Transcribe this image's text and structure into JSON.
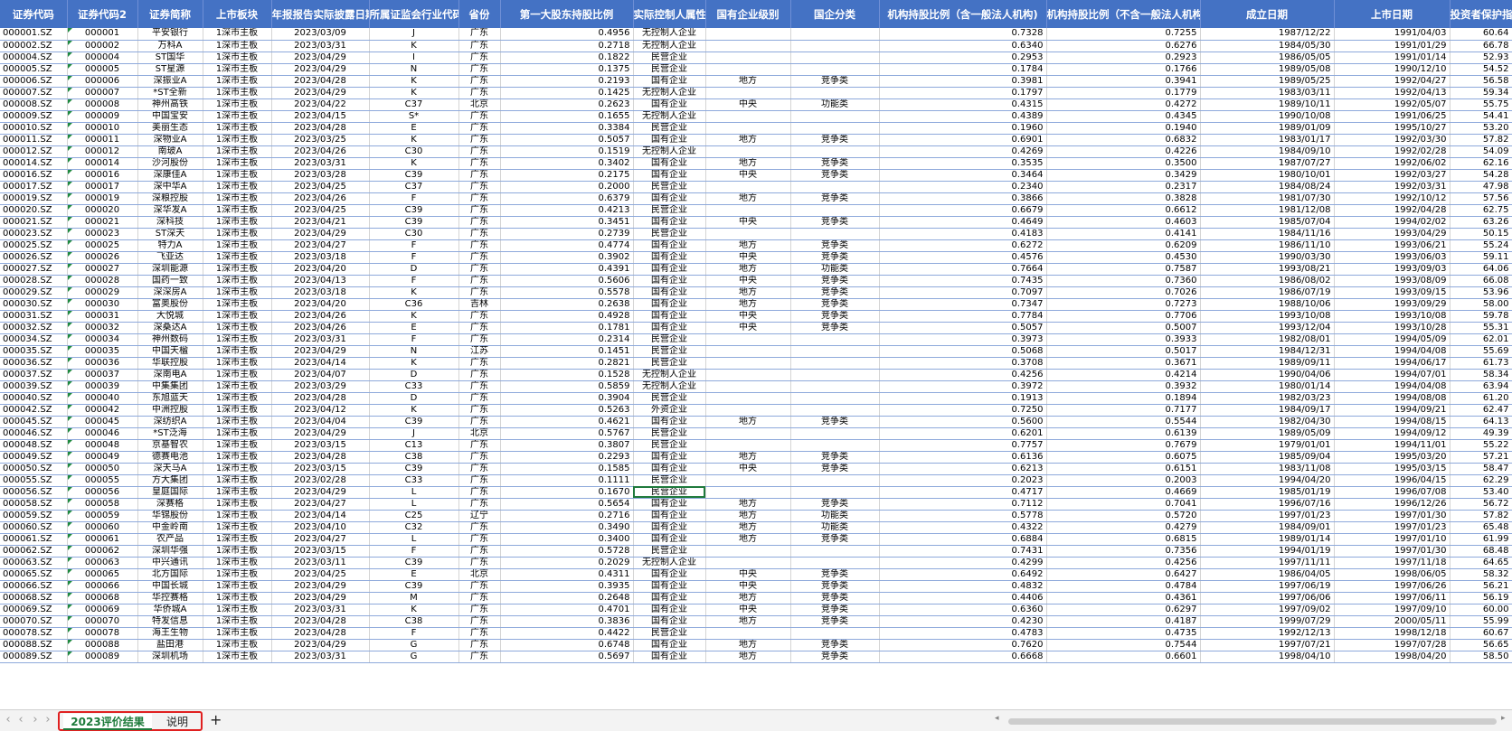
{
  "columns": [
    {
      "label": "证券代码",
      "align": "l"
    },
    {
      "label": "证券代码2",
      "align": "c"
    },
    {
      "label": "证券简称",
      "align": "c"
    },
    {
      "label": "上市板块",
      "align": "c"
    },
    {
      "label": "年报报告实际披露日期",
      "align": "c"
    },
    {
      "label": "所属证监会行业代码",
      "align": "c"
    },
    {
      "label": "省份",
      "align": "c"
    },
    {
      "label": "第一大股东持股比例",
      "align": "r"
    },
    {
      "label": "实际控制人属性",
      "align": "c"
    },
    {
      "label": "国有企业级别",
      "align": "c"
    },
    {
      "label": "国企分类",
      "align": "c"
    },
    {
      "label": "机构持股比例（含一般法人机构)",
      "align": "r"
    },
    {
      "label": "机构持股比例（不含一般法人机构)",
      "align": "r"
    },
    {
      "label": "成立日期",
      "align": "r"
    },
    {
      "label": "上市日期",
      "align": "r"
    },
    {
      "label": "投资者保护指数",
      "align": "r"
    }
  ],
  "rows": [
    [
      "000001.SZ",
      "000001",
      "平安银行",
      "1深市主板",
      "2023/03/09",
      "J",
      "广东",
      "0.4956",
      "无控制人企业",
      "",
      "",
      "0.7328",
      "0.7255",
      "1987/12/22",
      "1991/04/03",
      "60.64"
    ],
    [
      "000002.SZ",
      "000002",
      "万科A",
      "1深市主板",
      "2023/03/31",
      "K",
      "广东",
      "0.2718",
      "无控制人企业",
      "",
      "",
      "0.6340",
      "0.6276",
      "1984/05/30",
      "1991/01/29",
      "66.78"
    ],
    [
      "000004.SZ",
      "000004",
      "ST国华",
      "1深市主板",
      "2023/04/29",
      "I",
      "广东",
      "0.1822",
      "民营企业",
      "",
      "",
      "0.2953",
      "0.2923",
      "1986/05/05",
      "1991/01/14",
      "52.93"
    ],
    [
      "000005.SZ",
      "000005",
      "ST星源",
      "1深市主板",
      "2023/04/29",
      "N",
      "广东",
      "0.1375",
      "民营企业",
      "",
      "",
      "0.1784",
      "0.1766",
      "1989/05/08",
      "1990/12/10",
      "54.52"
    ],
    [
      "000006.SZ",
      "000006",
      "深振业A",
      "1深市主板",
      "2023/04/28",
      "K",
      "广东",
      "0.2193",
      "国有企业",
      "地方",
      "竞争类",
      "0.3981",
      "0.3941",
      "1989/05/25",
      "1992/04/27",
      "56.58"
    ],
    [
      "000007.SZ",
      "000007",
      "*ST全新",
      "1深市主板",
      "2023/04/29",
      "K",
      "广东",
      "0.1425",
      "无控制人企业",
      "",
      "",
      "0.1797",
      "0.1779",
      "1983/03/11",
      "1992/04/13",
      "59.34"
    ],
    [
      "000008.SZ",
      "000008",
      "神州高铁",
      "1深市主板",
      "2023/04/22",
      "C37",
      "北京",
      "0.2623",
      "国有企业",
      "中央",
      "功能类",
      "0.4315",
      "0.4272",
      "1989/10/11",
      "1992/05/07",
      "55.75"
    ],
    [
      "000009.SZ",
      "000009",
      "中国宝安",
      "1深市主板",
      "2023/04/15",
      "S*",
      "广东",
      "0.1655",
      "无控制人企业",
      "",
      "",
      "0.4389",
      "0.4345",
      "1990/10/08",
      "1991/06/25",
      "54.41"
    ],
    [
      "000010.SZ",
      "000010",
      "美丽生态",
      "1深市主板",
      "2023/04/28",
      "E",
      "广东",
      "0.3384",
      "民营企业",
      "",
      "",
      "0.1960",
      "0.1940",
      "1989/01/09",
      "1995/10/27",
      "53.20"
    ],
    [
      "000011.SZ",
      "000011",
      "深物业A",
      "1深市主板",
      "2023/03/25",
      "K",
      "广东",
      "0.5057",
      "国有企业",
      "地方",
      "竞争类",
      "0.6901",
      "0.6832",
      "1983/01/17",
      "1992/03/30",
      "57.82"
    ],
    [
      "000012.SZ",
      "000012",
      "南玻A",
      "1深市主板",
      "2023/04/26",
      "C30",
      "广东",
      "0.1519",
      "无控制人企业",
      "",
      "",
      "0.4269",
      "0.4226",
      "1984/09/10",
      "1992/02/28",
      "54.09"
    ],
    [
      "000014.SZ",
      "000014",
      "沙河股份",
      "1深市主板",
      "2023/03/31",
      "K",
      "广东",
      "0.3402",
      "国有企业",
      "地方",
      "竞争类",
      "0.3535",
      "0.3500",
      "1987/07/27",
      "1992/06/02",
      "62.16"
    ],
    [
      "000016.SZ",
      "000016",
      "深康佳A",
      "1深市主板",
      "2023/03/28",
      "C39",
      "广东",
      "0.2175",
      "国有企业",
      "中央",
      "竞争类",
      "0.3464",
      "0.3429",
      "1980/10/01",
      "1992/03/27",
      "54.28"
    ],
    [
      "000017.SZ",
      "000017",
      "深中华A",
      "1深市主板",
      "2023/04/25",
      "C37",
      "广东",
      "0.2000",
      "民营企业",
      "",
      "",
      "0.2340",
      "0.2317",
      "1984/08/24",
      "1992/03/31",
      "47.98"
    ],
    [
      "000019.SZ",
      "000019",
      "深粮控股",
      "1深市主板",
      "2023/04/26",
      "F",
      "广东",
      "0.6379",
      "国有企业",
      "地方",
      "竞争类",
      "0.3866",
      "0.3828",
      "1981/07/30",
      "1992/10/12",
      "57.56"
    ],
    [
      "000020.SZ",
      "000020",
      "深华发A",
      "1深市主板",
      "2023/04/25",
      "C39",
      "广东",
      "0.4213",
      "民营企业",
      "",
      "",
      "0.6679",
      "0.6612",
      "1981/12/08",
      "1992/04/28",
      "62.75"
    ],
    [
      "000021.SZ",
      "000021",
      "深科技",
      "1深市主板",
      "2023/04/21",
      "C39",
      "广东",
      "0.3451",
      "国有企业",
      "中央",
      "竞争类",
      "0.4649",
      "0.4603",
      "1985/07/04",
      "1994/02/02",
      "63.26"
    ],
    [
      "000023.SZ",
      "000023",
      "ST深天",
      "1深市主板",
      "2023/04/29",
      "C30",
      "广东",
      "0.2739",
      "民营企业",
      "",
      "",
      "0.4183",
      "0.4141",
      "1984/11/16",
      "1993/04/29",
      "50.15"
    ],
    [
      "000025.SZ",
      "000025",
      "特力A",
      "1深市主板",
      "2023/04/27",
      "F",
      "广东",
      "0.4774",
      "国有企业",
      "地方",
      "竞争类",
      "0.6272",
      "0.6209",
      "1986/11/10",
      "1993/06/21",
      "55.24"
    ],
    [
      "000026.SZ",
      "000026",
      "飞亚达",
      "1深市主板",
      "2023/03/18",
      "F",
      "广东",
      "0.3902",
      "国有企业",
      "中央",
      "竞争类",
      "0.4576",
      "0.4530",
      "1990/03/30",
      "1993/06/03",
      "59.11"
    ],
    [
      "000027.SZ",
      "000027",
      "深圳能源",
      "1深市主板",
      "2023/04/20",
      "D",
      "广东",
      "0.4391",
      "国有企业",
      "地方",
      "功能类",
      "0.7664",
      "0.7587",
      "1993/08/21",
      "1993/09/03",
      "64.06"
    ],
    [
      "000028.SZ",
      "000028",
      "国药一致",
      "1深市主板",
      "2023/04/13",
      "F",
      "广东",
      "0.5606",
      "国有企业",
      "中央",
      "竞争类",
      "0.7435",
      "0.7360",
      "1986/08/02",
      "1993/08/09",
      "66.08"
    ],
    [
      "000029.SZ",
      "000029",
      "深深房A",
      "1深市主板",
      "2023/03/18",
      "K",
      "广东",
      "0.5578",
      "国有企业",
      "地方",
      "竞争类",
      "0.7097",
      "0.7026",
      "1986/07/19",
      "1993/09/15",
      "53.96"
    ],
    [
      "000030.SZ",
      "000030",
      "富奥股份",
      "1深市主板",
      "2023/04/20",
      "C36",
      "吉林",
      "0.2638",
      "国有企业",
      "地方",
      "竞争类",
      "0.7347",
      "0.7273",
      "1988/10/06",
      "1993/09/29",
      "58.00"
    ],
    [
      "000031.SZ",
      "000031",
      "大悦城",
      "1深市主板",
      "2023/04/26",
      "K",
      "广东",
      "0.4928",
      "国有企业",
      "中央",
      "竞争类",
      "0.7784",
      "0.7706",
      "1993/10/08",
      "1993/10/08",
      "59.78"
    ],
    [
      "000032.SZ",
      "000032",
      "深桑达A",
      "1深市主板",
      "2023/04/26",
      "E",
      "广东",
      "0.1781",
      "国有企业",
      "中央",
      "竞争类",
      "0.5057",
      "0.5007",
      "1993/12/04",
      "1993/10/28",
      "55.31"
    ],
    [
      "000034.SZ",
      "000034",
      "神州数码",
      "1深市主板",
      "2023/03/31",
      "F",
      "广东",
      "0.2314",
      "民营企业",
      "",
      "",
      "0.3973",
      "0.3933",
      "1982/08/01",
      "1994/05/09",
      "62.01"
    ],
    [
      "000035.SZ",
      "000035",
      "中国天楹",
      "1深市主板",
      "2023/04/29",
      "N",
      "江苏",
      "0.1451",
      "民营企业",
      "",
      "",
      "0.5068",
      "0.5017",
      "1984/12/31",
      "1994/04/08",
      "55.69"
    ],
    [
      "000036.SZ",
      "000036",
      "华联控股",
      "1深市主板",
      "2023/04/14",
      "K",
      "广东",
      "0.2821",
      "民营企业",
      "",
      "",
      "0.3708",
      "0.3671",
      "1989/09/11",
      "1994/06/17",
      "61.73"
    ],
    [
      "000037.SZ",
      "000037",
      "深南电A",
      "1深市主板",
      "2023/04/07",
      "D",
      "广东",
      "0.1528",
      "无控制人企业",
      "",
      "",
      "0.4256",
      "0.4214",
      "1990/04/06",
      "1994/07/01",
      "58.34"
    ],
    [
      "000039.SZ",
      "000039",
      "中集集团",
      "1深市主板",
      "2023/03/29",
      "C33",
      "广东",
      "0.5859",
      "无控制人企业",
      "",
      "",
      "0.3972",
      "0.3932",
      "1980/01/14",
      "1994/04/08",
      "63.94"
    ],
    [
      "000040.SZ",
      "000040",
      "东旭蓝天",
      "1深市主板",
      "2023/04/28",
      "D",
      "广东",
      "0.3904",
      "民营企业",
      "",
      "",
      "0.1913",
      "0.1894",
      "1982/03/23",
      "1994/08/08",
      "61.20"
    ],
    [
      "000042.SZ",
      "000042",
      "中洲控股",
      "1深市主板",
      "2023/04/12",
      "K",
      "广东",
      "0.5263",
      "外资企业",
      "",
      "",
      "0.7250",
      "0.7177",
      "1984/09/17",
      "1994/09/21",
      "62.47"
    ],
    [
      "000045.SZ",
      "000045",
      "深纺织A",
      "1深市主板",
      "2023/04/04",
      "C39",
      "广东",
      "0.4621",
      "国有企业",
      "地方",
      "竞争类",
      "0.5600",
      "0.5544",
      "1982/04/30",
      "1994/08/15",
      "64.13"
    ],
    [
      "000046.SZ",
      "000046",
      "*ST泛海",
      "1深市主板",
      "2023/04/29",
      "J",
      "北京",
      "0.5767",
      "民营企业",
      "",
      "",
      "0.6201",
      "0.6139",
      "1989/05/09",
      "1994/09/12",
      "49.39"
    ],
    [
      "000048.SZ",
      "000048",
      "京基智农",
      "1深市主板",
      "2023/03/15",
      "C13",
      "广东",
      "0.3807",
      "民营企业",
      "",
      "",
      "0.7757",
      "0.7679",
      "1979/01/01",
      "1994/11/01",
      "55.22"
    ],
    [
      "000049.SZ",
      "000049",
      "德赛电池",
      "1深市主板",
      "2023/04/28",
      "C38",
      "广东",
      "0.2293",
      "国有企业",
      "地方",
      "竞争类",
      "0.6136",
      "0.6075",
      "1985/09/04",
      "1995/03/20",
      "57.21"
    ],
    [
      "000050.SZ",
      "000050",
      "深天马A",
      "1深市主板",
      "2023/03/15",
      "C39",
      "广东",
      "0.1585",
      "国有企业",
      "中央",
      "竞争类",
      "0.6213",
      "0.6151",
      "1983/11/08",
      "1995/03/15",
      "58.47"
    ],
    [
      "000055.SZ",
      "000055",
      "方大集团",
      "1深市主板",
      "2023/02/28",
      "C33",
      "广东",
      "0.1111",
      "民营企业",
      "",
      "",
      "0.2023",
      "0.2003",
      "1994/04/20",
      "1996/04/15",
      "62.29"
    ],
    [
      "000056.SZ",
      "000056",
      "皇庭国际",
      "1深市主板",
      "2023/04/29",
      "L",
      "广东",
      "0.1670",
      "民营企业",
      "",
      "",
      "0.4717",
      "0.4669",
      "1985/01/19",
      "1996/07/08",
      "53.40"
    ],
    [
      "000058.SZ",
      "000058",
      "深赛格",
      "1深市主板",
      "2023/04/27",
      "L",
      "广东",
      "0.5654",
      "国有企业",
      "地方",
      "竞争类",
      "0.7112",
      "0.7041",
      "1996/07/16",
      "1996/12/26",
      "56.72"
    ],
    [
      "000059.SZ",
      "000059",
      "华锦股份",
      "1深市主板",
      "2023/04/14",
      "C25",
      "辽宁",
      "0.2716",
      "国有企业",
      "地方",
      "功能类",
      "0.5778",
      "0.5720",
      "1997/01/23",
      "1997/01/30",
      "57.82"
    ],
    [
      "000060.SZ",
      "000060",
      "中金岭南",
      "1深市主板",
      "2023/04/10",
      "C32",
      "广东",
      "0.3490",
      "国有企业",
      "地方",
      "功能类",
      "0.4322",
      "0.4279",
      "1984/09/01",
      "1997/01/23",
      "65.48"
    ],
    [
      "000061.SZ",
      "000061",
      "农产品",
      "1深市主板",
      "2023/04/27",
      "L",
      "广东",
      "0.3400",
      "国有企业",
      "地方",
      "竞争类",
      "0.6884",
      "0.6815",
      "1989/01/14",
      "1997/01/10",
      "61.99"
    ],
    [
      "000062.SZ",
      "000062",
      "深圳华强",
      "1深市主板",
      "2023/03/15",
      "F",
      "广东",
      "0.5728",
      "民营企业",
      "",
      "",
      "0.7431",
      "0.7356",
      "1994/01/19",
      "1997/01/30",
      "68.48"
    ],
    [
      "000063.SZ",
      "000063",
      "中兴通讯",
      "1深市主板",
      "2023/03/11",
      "C39",
      "广东",
      "0.2029",
      "无控制人企业",
      "",
      "",
      "0.4299",
      "0.4256",
      "1997/11/11",
      "1997/11/18",
      "64.65"
    ],
    [
      "000065.SZ",
      "000065",
      "北方国际",
      "1深市主板",
      "2023/04/25",
      "E",
      "北京",
      "0.4311",
      "国有企业",
      "中央",
      "竞争类",
      "0.6492",
      "0.6427",
      "1986/04/05",
      "1998/06/05",
      "58.32"
    ],
    [
      "000066.SZ",
      "000066",
      "中国长城",
      "1深市主板",
      "2023/04/29",
      "C39",
      "广东",
      "0.3935",
      "国有企业",
      "中央",
      "竞争类",
      "0.4832",
      "0.4784",
      "1997/06/19",
      "1997/06/26",
      "56.21"
    ],
    [
      "000068.SZ",
      "000068",
      "华控赛格",
      "1深市主板",
      "2023/04/29",
      "M",
      "广东",
      "0.2648",
      "国有企业",
      "地方",
      "竞争类",
      "0.4406",
      "0.4361",
      "1997/06/06",
      "1997/06/11",
      "56.19"
    ],
    [
      "000069.SZ",
      "000069",
      "华侨城A",
      "1深市主板",
      "2023/03/31",
      "K",
      "广东",
      "0.4701",
      "国有企业",
      "中央",
      "竞争类",
      "0.6360",
      "0.6297",
      "1997/09/02",
      "1997/09/10",
      "60.00"
    ],
    [
      "000070.SZ",
      "000070",
      "特发信息",
      "1深市主板",
      "2023/04/28",
      "C38",
      "广东",
      "0.3836",
      "国有企业",
      "地方",
      "竞争类",
      "0.4230",
      "0.4187",
      "1999/07/29",
      "2000/05/11",
      "55.99"
    ],
    [
      "000078.SZ",
      "000078",
      "海王生物",
      "1深市主板",
      "2023/04/28",
      "F",
      "广东",
      "0.4422",
      "民营企业",
      "",
      "",
      "0.4783",
      "0.4735",
      "1992/12/13",
      "1998/12/18",
      "60.67"
    ],
    [
      "000088.SZ",
      "000088",
      "盐田港",
      "1深市主板",
      "2023/04/29",
      "G",
      "广东",
      "0.6748",
      "国有企业",
      "地方",
      "竞争类",
      "0.7620",
      "0.7544",
      "1997/07/21",
      "1997/07/28",
      "56.65"
    ],
    [
      "000089.SZ",
      "000089",
      "深圳机场",
      "1深市主板",
      "2023/03/31",
      "G",
      "广东",
      "0.5697",
      "国有企业",
      "地方",
      "竞争类",
      "0.6668",
      "0.6601",
      "1998/04/10",
      "1998/04/20",
      "58.50"
    ]
  ],
  "tabs": {
    "prev_first": "‹",
    "prev": "‹",
    "next": "›",
    "next_last": "›",
    "active": "2023评价结果",
    "other": "说明",
    "add": "+"
  },
  "scroll": {
    "left": "◂",
    "right": "▸"
  }
}
